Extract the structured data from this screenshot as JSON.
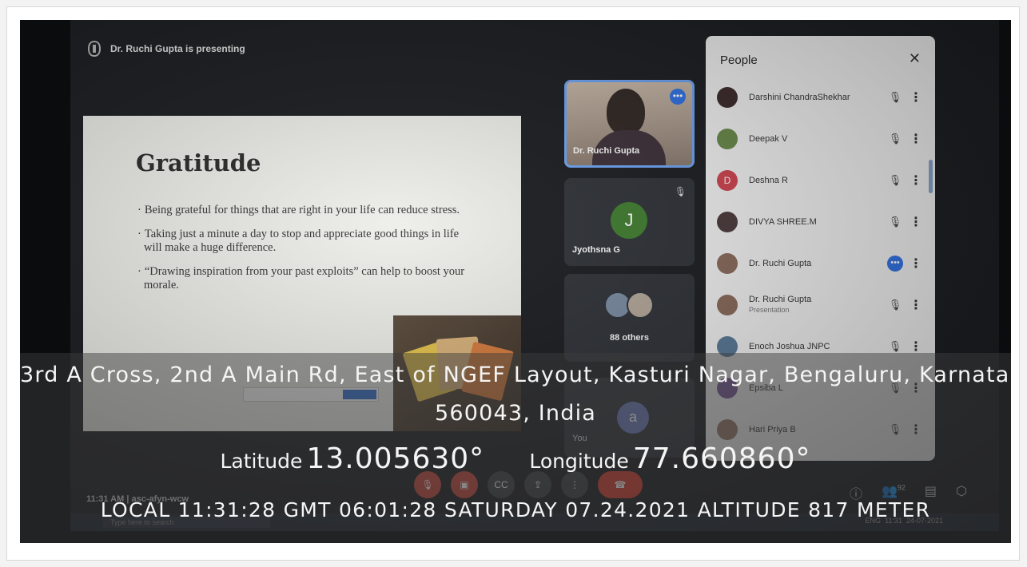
{
  "meeting": {
    "presenting_text": "Dr. Ruchi Gupta is presenting",
    "meeting_time": "11:31 AM",
    "meeting_code": "asc-afyn-wcw",
    "participant_count": "92"
  },
  "slide": {
    "title": "Gratitude",
    "bullets": [
      "Being grateful for things that are right in your life can reduce stress.",
      "Taking just a minute a day to stop and appreciate good things in life will make a huge difference.",
      "“Drawing inspiration from your past exploits” can help to boost your morale."
    ]
  },
  "tiles": {
    "presenter_name": "Dr. Ruchi Gupta",
    "tile2_initial": "J",
    "tile2_name": "Jyothsna G",
    "others_label": "88 others",
    "you_initial": "a",
    "you_label": "You"
  },
  "people_panel": {
    "title": "People",
    "close": "✕",
    "participants": [
      {
        "name": "Darshini ChandraShekhar",
        "sub": "",
        "initial": "",
        "color": "#3b2a2a"
      },
      {
        "name": "Deepak V",
        "sub": "",
        "initial": "",
        "color": "#6a8a4a"
      },
      {
        "name": "Deshna R",
        "sub": "",
        "initial": "D",
        "color": "#d0434f"
      },
      {
        "name": "DIVYA SHREE.M",
        "sub": "",
        "initial": "",
        "color": "#4a3a3a"
      },
      {
        "name": "Dr. Ruchi Gupta",
        "sub": "",
        "initial": "",
        "color": "#8a6a5a"
      },
      {
        "name": "Dr. Ruchi Gupta",
        "sub": "Presentation",
        "initial": "",
        "color": "#8a6a5a"
      },
      {
        "name": "Enoch Joshua JNPC",
        "sub": "",
        "initial": "",
        "color": "#5a7a9a"
      },
      {
        "name": "Epsiba L",
        "sub": "",
        "initial": "",
        "color": "#7a5a9a"
      },
      {
        "name": "Hari Priya B",
        "sub": "",
        "initial": "",
        "color": "#9a7a6a"
      }
    ]
  },
  "overlay": {
    "address_line1": "3rd A Cross, 2nd A Main Rd, East of NGEF Layout, Kasturi Nagar, Bengaluru, Karnataka",
    "address_line2": "560043, India",
    "latitude_label": "Latitude",
    "latitude_value": "13.005630°",
    "longitude_label": "Longitude",
    "longitude_value": "77.660860°",
    "meta_line": "LOCAL 11:31:28  GMT 06:01:28  SATURDAY 07.24.2021  ALTITUDE 817 METER"
  },
  "taskbar": {
    "search_placeholder": "Type here to search",
    "tray_lang": "ENG",
    "tray_time": "11:31",
    "tray_date": "24-07-2021"
  },
  "colors": {
    "accent_blue": "#2f72e6",
    "end_call_red": "#d93d2f",
    "presenter_border": "#6ea4f5"
  }
}
